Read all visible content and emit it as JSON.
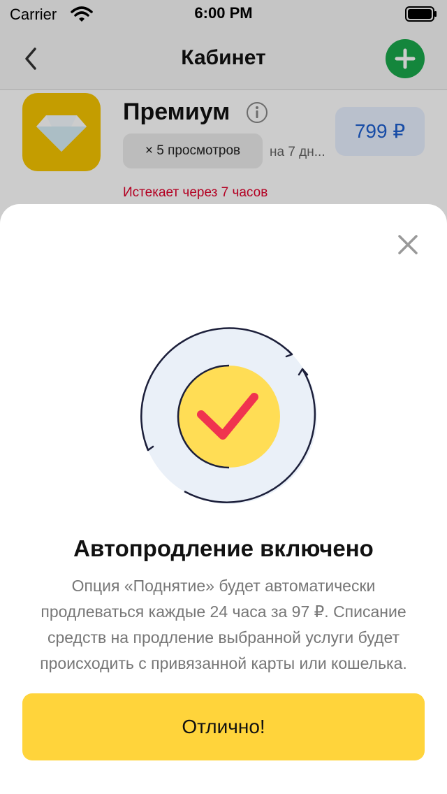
{
  "status_bar": {
    "carrier": "Carrier",
    "time": "6:00 PM"
  },
  "nav": {
    "title": "Кабинет",
    "back_icon": "chevron-left-icon",
    "add_icon": "plus-icon"
  },
  "card": {
    "title": "Премиум",
    "views_chip": "× 5 просмотров",
    "duration": "на 7 дн...",
    "price": "799 ₽",
    "expires": "Истекает через 7 часов"
  },
  "sheet": {
    "title": "Автопродление включено",
    "description": "Опция «Поднятие» будет автоматически продлеваться каждые 24 часа за 97 ₽. Списание средств на продление выбранной услуги будет происходить с привязанной карты или кошелька.",
    "ok_button": "Отлично!",
    "close_icon": "close-icon"
  },
  "colors": {
    "accent_yellow": "#ffd43b",
    "add_green": "#1aa84b",
    "price_blue": "#1d5fd0",
    "alert_red": "#e0002b",
    "check_red": "#f0334f"
  }
}
